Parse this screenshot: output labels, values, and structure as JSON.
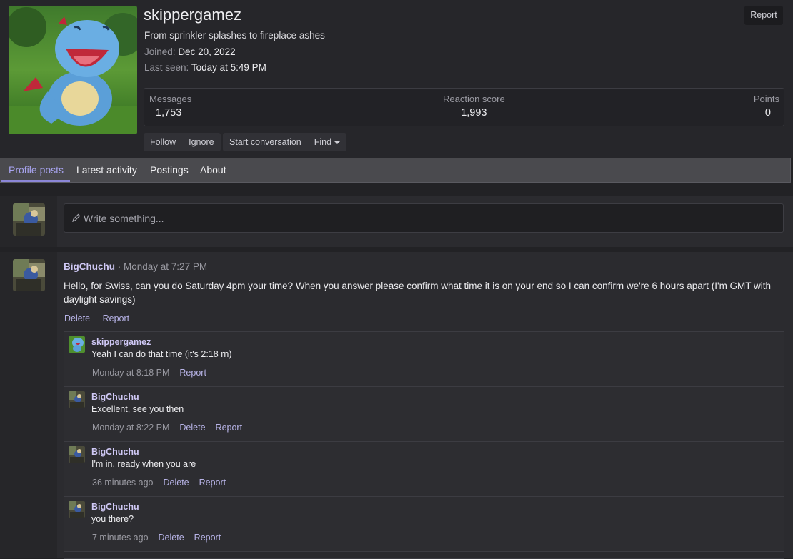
{
  "profile": {
    "username": "skippergamez",
    "tagline": "From sprinkler splashes to fireplace ashes",
    "joined_label": "Joined:",
    "joined_value": "Dec 20, 2022",
    "last_seen_label": "Last seen:",
    "last_seen_value": "Today at 5:49 PM",
    "report_label": "Report"
  },
  "stats": {
    "messages_label": "Messages",
    "messages_value": "1,753",
    "reaction_label": "Reaction score",
    "reaction_value": "1,993",
    "points_label": "Points",
    "points_value": "0"
  },
  "actions": {
    "follow": "Follow",
    "ignore": "Ignore",
    "start_conversation": "Start conversation",
    "find": "Find"
  },
  "tabs": [
    "Profile posts",
    "Latest activity",
    "Postings",
    "About"
  ],
  "composer": {
    "placeholder": "Write something..."
  },
  "post": {
    "author": "BigChuchu",
    "time": "· Monday at 7:27 PM",
    "body": "Hello, for Swiss, can you do Saturday 4pm your time? When you answer please confirm what time it is on your end so I can confirm we're 6 hours apart (I'm GMT with daylight savings)",
    "delete_label": "Delete",
    "report_label": "Report"
  },
  "replies": [
    {
      "author": "skippergamez",
      "text": "Yeah I can do that time (it's 2:18 rn)",
      "time": "Monday at 8:18 PM",
      "actions": [
        "Report"
      ],
      "avatar": "totodile"
    },
    {
      "author": "BigChuchu",
      "text": "Excellent, see you then",
      "time": "Monday at 8:22 PM",
      "actions": [
        "Delete",
        "Report"
      ],
      "avatar": "chuchu"
    },
    {
      "author": "BigChuchu",
      "text": "I'm in, ready when you are",
      "time": "36 minutes ago",
      "actions": [
        "Delete",
        "Report"
      ],
      "avatar": "chuchu"
    },
    {
      "author": "BigChuchu",
      "text": "you there?",
      "time": "7 minutes ago",
      "actions": [
        "Delete",
        "Report"
      ],
      "avatar": "chuchu"
    }
  ],
  "colors": {
    "accent": "#8b86d8",
    "link": "#b8b4e8",
    "username": "#cfc8f5",
    "background": "#222225"
  }
}
